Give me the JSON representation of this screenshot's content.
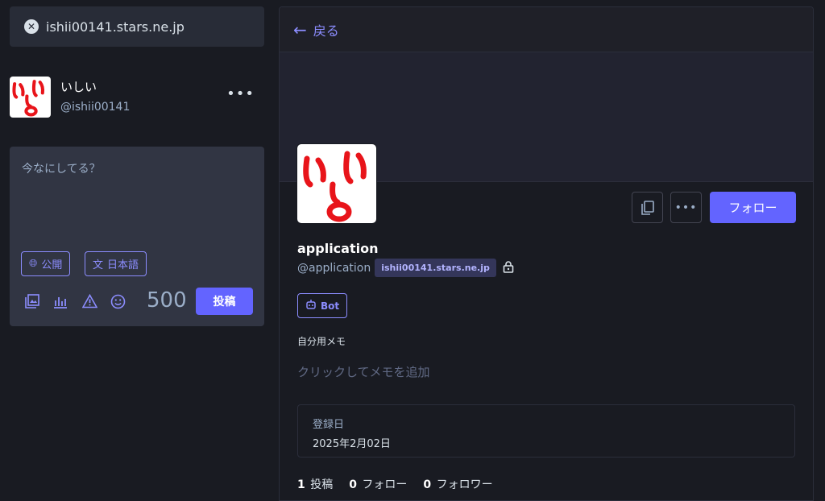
{
  "search": {
    "query": "ishii00141.stars.ne.jp"
  },
  "account": {
    "display_name": "いしい",
    "handle": "@ishii00141",
    "more_label": "•••"
  },
  "compose": {
    "placeholder": "今なにしてる？",
    "visibility_label": "公開",
    "language_label": "日本語",
    "char_count": "500",
    "post_label": "投稿"
  },
  "profile": {
    "back_label": "戻る",
    "follow_label": "フォロー",
    "display_name": "application",
    "username": "@application",
    "domain": "ishii00141.stars.ne.jp",
    "bot_label": "Bot",
    "memo_label": "自分用メモ",
    "memo_placeholder": "クリックしてメモを追加",
    "joined_label": "登録日",
    "joined_value": "2025年2月02日",
    "stats": {
      "posts_count": "1",
      "posts_label": "投稿",
      "following_count": "0",
      "following_label": "フォロー",
      "followers_count": "0",
      "followers_label": "フォロワー"
    }
  },
  "colors": {
    "accent": "#6364ff",
    "accent_text": "#8c8dff",
    "background": "#191b22",
    "panel": "#313543",
    "avatar_ink": "#e8141a"
  },
  "icons": [
    "close-icon",
    "globe-icon",
    "translate-icon",
    "image-icon",
    "poll-icon",
    "warning-icon",
    "emoji-icon",
    "arrow-left-icon",
    "copy-icon",
    "more-icon",
    "lock-icon",
    "bot-icon"
  ]
}
